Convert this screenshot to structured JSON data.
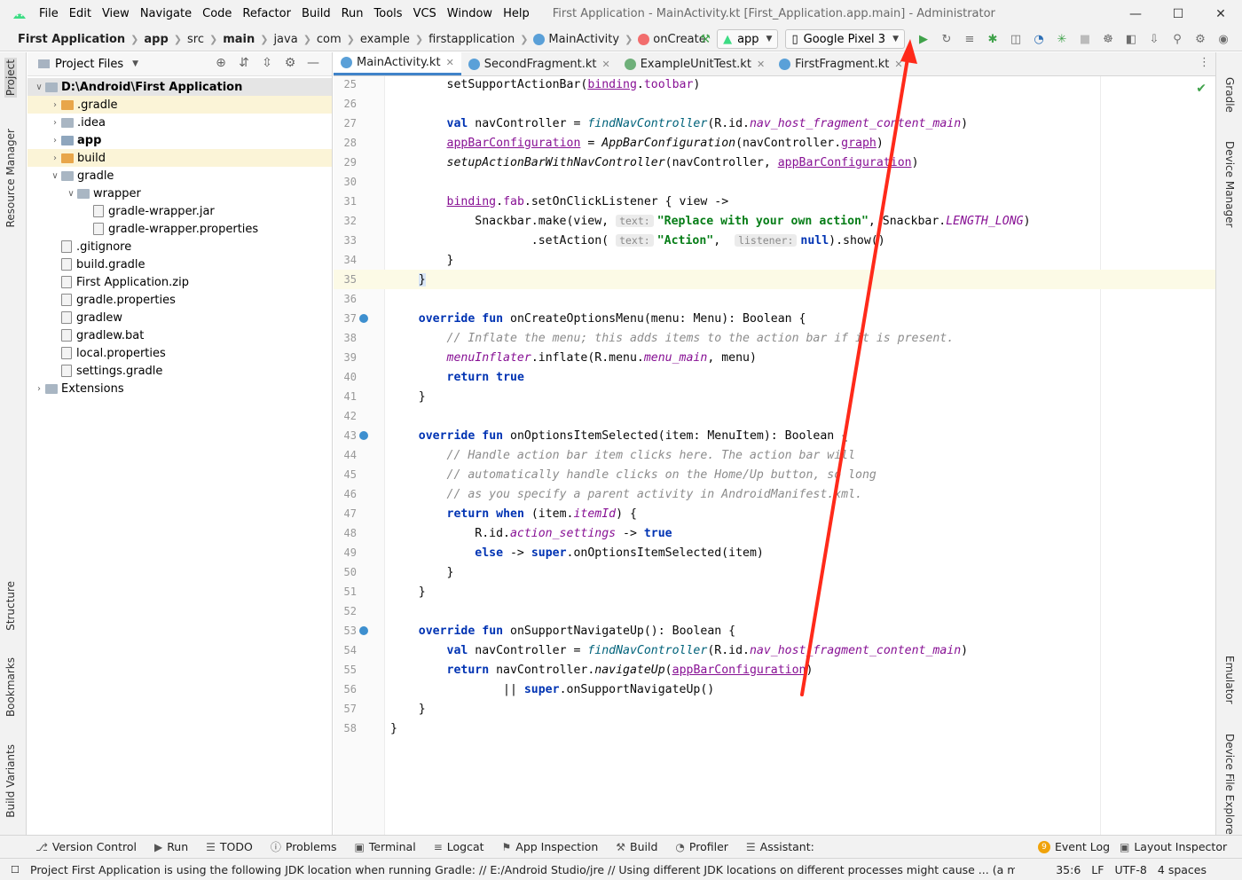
{
  "menu": [
    "File",
    "Edit",
    "View",
    "Navigate",
    "Code",
    "Refactor",
    "Build",
    "Run",
    "Tools",
    "VCS",
    "Window",
    "Help"
  ],
  "window_title": "First Application - MainActivity.kt [First_Application.app.main] - Administrator",
  "breadcrumb": [
    "First Application",
    "app",
    "src",
    "main",
    "java",
    "com",
    "example",
    "firstapplication",
    "MainActivity",
    "onCreate"
  ],
  "run_config": "app",
  "device": "Google Pixel 3",
  "panel": {
    "title": "Project Files"
  },
  "tree": [
    {
      "label": "D:\\Android\\First Application",
      "depth": 0,
      "arrow": "open",
      "kind": "folder",
      "bold": true
    },
    {
      "label": ".gradle",
      "depth": 1,
      "arrow": "closed",
      "kind": "folder-orange"
    },
    {
      "label": ".idea",
      "depth": 1,
      "arrow": "closed",
      "kind": "folder"
    },
    {
      "label": "app",
      "depth": 1,
      "arrow": "closed",
      "kind": "folder-module",
      "bold": true
    },
    {
      "label": "build",
      "depth": 1,
      "arrow": "closed",
      "kind": "folder-orange"
    },
    {
      "label": "gradle",
      "depth": 1,
      "arrow": "open",
      "kind": "folder"
    },
    {
      "label": "wrapper",
      "depth": 2,
      "arrow": "open",
      "kind": "folder"
    },
    {
      "label": "gradle-wrapper.jar",
      "depth": 3,
      "arrow": "none",
      "kind": "file"
    },
    {
      "label": "gradle-wrapper.properties",
      "depth": 3,
      "arrow": "none",
      "kind": "file"
    },
    {
      "label": ".gitignore",
      "depth": 1,
      "arrow": "none",
      "kind": "file"
    },
    {
      "label": "build.gradle",
      "depth": 1,
      "arrow": "none",
      "kind": "file"
    },
    {
      "label": "First Application.zip",
      "depth": 1,
      "arrow": "none",
      "kind": "file"
    },
    {
      "label": "gradle.properties",
      "depth": 1,
      "arrow": "none",
      "kind": "file"
    },
    {
      "label": "gradlew",
      "depth": 1,
      "arrow": "none",
      "kind": "file"
    },
    {
      "label": "gradlew.bat",
      "depth": 1,
      "arrow": "none",
      "kind": "file"
    },
    {
      "label": "local.properties",
      "depth": 1,
      "arrow": "none",
      "kind": "file"
    },
    {
      "label": "settings.gradle",
      "depth": 1,
      "arrow": "none",
      "kind": "file"
    },
    {
      "label": "Extensions",
      "depth": 0,
      "arrow": "closed",
      "kind": "folder"
    }
  ],
  "tabs": [
    {
      "label": "MainActivity.kt",
      "active": true
    },
    {
      "label": "SecondFragment.kt",
      "active": false
    },
    {
      "label": "ExampleUnitTest.kt",
      "active": false
    },
    {
      "label": "FirstFragment.kt",
      "active": false
    }
  ],
  "code_lines": [
    {
      "n": "25",
      "html": "        setSupportActionBar(<span class=\"prop ul\">binding</span>.<span class=\"prop\">toolbar</span>)"
    },
    {
      "n": "26",
      "html": ""
    },
    {
      "n": "27",
      "html": "        <span class=\"kw\">val</span> navController = <span class=\"fn-i\">findNavController</span>(R.id.<span class=\"prop\" style=\"font-style:italic\">nav_host_fragment_content_main</span>)"
    },
    {
      "n": "28",
      "html": "        <span class=\"prop ul\">appBarConfiguration</span> = <span style=\"font-style:italic\">AppBarConfiguration</span>(navController.<span class=\"prop ul\">graph</span>)"
    },
    {
      "n": "29",
      "html": "        <span style=\"font-style:italic\">setupActionBarWithNavController</span>(navController, <span class=\"prop ul\">appBarConfiguration</span>)"
    },
    {
      "n": "30",
      "html": ""
    },
    {
      "n": "31",
      "html": "        <span class=\"prop ul\">binding</span>.<span class=\"prop\">fab</span>.setOnClickListener { view ->"
    },
    {
      "n": "32",
      "html": "            Snackbar.make(view, <span class=\"hint\">text:</span><span class=\"str\">\"Replace with your own action\"</span>, Snackbar.<span class=\"prop\" style=\"font-style:italic\">LENGTH_LONG</span>)"
    },
    {
      "n": "33",
      "html": "                    .setAction( <span class=\"hint\">text:</span><span class=\"str\">\"Action\"</span>,  <span class=\"hint\">listener:</span><span class=\"kw\">null</span>).show()"
    },
    {
      "n": "34",
      "html": "        }"
    },
    {
      "n": "35",
      "html": "    <span style=\"background:#d9e6f7\">}</span>",
      "current": true
    },
    {
      "n": "36",
      "html": ""
    },
    {
      "n": "37",
      "html": "    <span class=\"kw\">override</span> <span class=\"kw\">fun</span> onCreateOptionsMenu(menu: Menu): Boolean {",
      "icon": true
    },
    {
      "n": "38",
      "html": "        <span class=\"cm\">// Inflate the menu; this adds items to the action bar if it is present.</span>"
    },
    {
      "n": "39",
      "html": "        <span class=\"prop\" style=\"font-style:italic\">menuInflater</span>.inflate(R.menu.<span class=\"prop\" style=\"font-style:italic\">menu_main</span>, menu)"
    },
    {
      "n": "40",
      "html": "        <span class=\"kw\">return</span> <span class=\"kw\">true</span>"
    },
    {
      "n": "41",
      "html": "    }"
    },
    {
      "n": "42",
      "html": ""
    },
    {
      "n": "43",
      "html": "    <span class=\"kw\">override</span> <span class=\"kw\">fun</span> onOptionsItemSelected(item: MenuItem): Boolean {",
      "icon": true
    },
    {
      "n": "44",
      "html": "        <span class=\"cm\">// Handle action bar item clicks here. The action bar will</span>"
    },
    {
      "n": "45",
      "html": "        <span class=\"cm\">// automatically handle clicks on the Home/Up button, so long</span>"
    },
    {
      "n": "46",
      "html": "        <span class=\"cm\">// as you specify a parent activity in AndroidManifest.xml.</span>"
    },
    {
      "n": "47",
      "html": "        <span class=\"kw\">return</span> <span class=\"kw\">when</span> (item.<span class=\"prop\" style=\"font-style:italic\">itemId</span>) {"
    },
    {
      "n": "48",
      "html": "            R.id.<span class=\"prop\" style=\"font-style:italic\">action_settings</span> -> <span class=\"kw\">true</span>"
    },
    {
      "n": "49",
      "html": "            <span class=\"kw\">else</span> -> <span class=\"kw\">super</span>.onOptionsItemSelected(item)"
    },
    {
      "n": "50",
      "html": "        }"
    },
    {
      "n": "51",
      "html": "    }"
    },
    {
      "n": "52",
      "html": ""
    },
    {
      "n": "53",
      "html": "    <span class=\"kw\">override</span> <span class=\"kw\">fun</span> onSupportNavigateUp(): Boolean {",
      "icon": true
    },
    {
      "n": "54",
      "html": "        <span class=\"kw\">val</span> navController = <span class=\"fn-i\">findNavController</span>(R.id.<span class=\"prop\" style=\"font-style:italic\">nav_host_fragment_content_main</span>)"
    },
    {
      "n": "55",
      "html": "        <span class=\"kw\">return</span> navController.<span style=\"font-style:italic\">navigateUp</span>(<span class=\"prop ul\">appBarConfiguration</span>)"
    },
    {
      "n": "56",
      "html": "                || <span class=\"kw\">super</span>.onSupportNavigateUp()"
    },
    {
      "n": "57",
      "html": "    }"
    },
    {
      "n": "58",
      "html": "}"
    }
  ],
  "left_tool_tabs": [
    "Project",
    "Resource Manager",
    "Structure",
    "Bookmarks",
    "Build Variants"
  ],
  "right_tool_tabs": [
    "Gradle",
    "Device Manager",
    "Emulator",
    "Device File Explorer"
  ],
  "bottom_tabs": [
    "Version Control",
    "Run",
    "TODO",
    "Problems",
    "Terminal",
    "Logcat",
    "App Inspection",
    "Build",
    "Profiler",
    "Assistant:",
    "Event Log",
    "Layout Inspector"
  ],
  "event_log_count": "9",
  "status": {
    "message": "Project First Application is using the following JDK location when running Gradle: // E:/Android Studio/jre // Using different JDK locations on different processes might cause ... (a minute ago)",
    "position": "35:6",
    "line_sep": "LF",
    "encoding": "UTF-8",
    "indent": "4 spaces"
  },
  "colors": {
    "accent": "#4083c9",
    "run_green": "#3fa24a",
    "annotation_arrow": "#ff2a1a"
  }
}
